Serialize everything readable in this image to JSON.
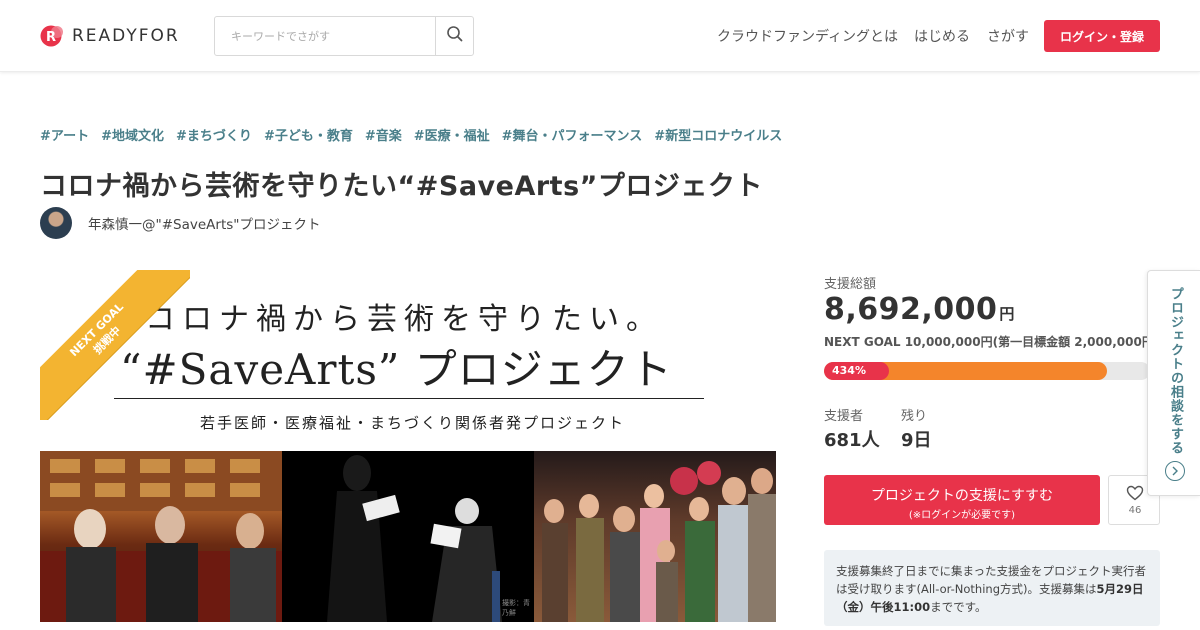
{
  "header": {
    "logo_text": "READYFOR",
    "brand_color": "#e8334a",
    "search_placeholder": "キーワードでさがす",
    "nav": [
      "クラウドファンディングとは",
      "はじめる",
      "さがす"
    ],
    "login_label": "ログイン・登録"
  },
  "project": {
    "tags": [
      "#アート",
      "#地域文化",
      "#まちづくり",
      "#子ども・教育",
      "#音楽",
      "#医療・福祉",
      "#舞台・パフォーマンス",
      "#新型コロナウイルス"
    ],
    "title": "コロナ禍から芸術を守りたい“#SaveArts”プロジェクト",
    "owner": "年森慎一@\"#SaveArts\"プロジェクト"
  },
  "hero": {
    "ribbon_line1": "NEXT GOAL",
    "ribbon_line2": "挑戦中",
    "line1": "コロナ禍から芸術を守りたい。",
    "line2": "“#SaveArts” プロジェクト",
    "line3": "若手医師・医療福祉・まちづくり関係者発プロジェクト",
    "credit": "撮影：青乃鮮"
  },
  "sidebar": {
    "total_label": "支援総額",
    "total_amount": "8,692,000",
    "total_unit": "円",
    "next_goal_text": "NEXT GOAL 10,000,000円(第一目標金額 2,000,000円)",
    "progress_label": "434%",
    "progress_fraction_next_goal": 0.869,
    "progress_fraction_first_goal": 0.2,
    "supporters_label": "支援者",
    "supporters_value": "681人",
    "remaining_label": "残り",
    "remaining_value": "9日",
    "support_button": "プロジェクトの支援にすすむ",
    "support_button_note": "(※ログインが必要です)",
    "favorite_count": "46",
    "notice_part1": "支援募集終了日までに集まった支援金をプロジェクト実行者は受け取ります(All-or-Nothing方式)。支援募集は",
    "notice_bold": "5月29日（金）午後11:00",
    "notice_part2": "までです。"
  },
  "floating_tab": {
    "label": "プロジェクトの相談をする"
  }
}
